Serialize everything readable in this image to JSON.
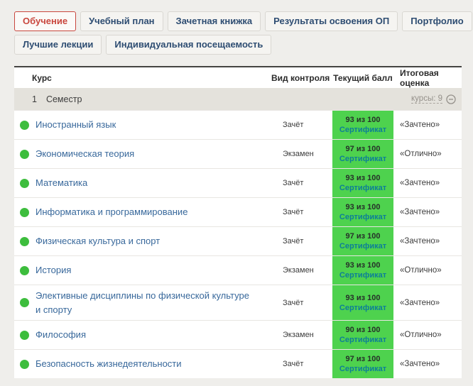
{
  "tabs": {
    "row1": [
      {
        "label": "Обучение",
        "active": true
      },
      {
        "label": "Учебный план",
        "active": false
      },
      {
        "label": "Зачетная книжка",
        "active": false
      },
      {
        "label": "Результаты освоения ОП",
        "active": false
      },
      {
        "label": "Портфолио",
        "active": false
      }
    ],
    "row2": [
      {
        "label": "Лучшие лекции",
        "active": false
      },
      {
        "label": "Индивидуальная посещаемость",
        "active": false
      }
    ]
  },
  "table": {
    "header": {
      "course": "Курс",
      "control": "Вид контроля",
      "score": "Текущий балл",
      "final": "Итоговая оценка"
    },
    "semester": {
      "number": "1",
      "label": "Семестр",
      "courses_link": "курсы: 9"
    },
    "rows": [
      {
        "name": "Иностранный язык",
        "control": "Зачёт",
        "score": "93 из 100",
        "cert": "Сертификат",
        "grade": "«Зачтено»",
        "status": "green"
      },
      {
        "name": "Экономическая теория",
        "control": "Экзамен",
        "score": "97 из 100",
        "cert": "Сертификат",
        "grade": "«Отлично»",
        "status": "green"
      },
      {
        "name": "Математика",
        "control": "Зачёт",
        "score": "93 из 100",
        "cert": "Сертификат",
        "grade": "«Зачтено»",
        "status": "green"
      },
      {
        "name": "Информатика и программирование",
        "control": "Зачёт",
        "score": "93 из 100",
        "cert": "Сертификат",
        "grade": "«Зачтено»",
        "status": "green"
      },
      {
        "name": "Физическая культура и спорт",
        "control": "Зачёт",
        "score": "97 из 100",
        "cert": "Сертификат",
        "grade": "«Зачтено»",
        "status": "green"
      },
      {
        "name": "История",
        "control": "Экзамен",
        "score": "93 из 100",
        "cert": "Сертификат",
        "grade": "«Отлично»",
        "status": "green"
      },
      {
        "name": "Элективные дисциплины по физической культуре и спорту",
        "control": "Зачёт",
        "score": "93 из 100",
        "cert": "Сертификат",
        "grade": "«Зачтено»",
        "status": "green"
      },
      {
        "name": "Философия",
        "control": "Экзамен",
        "score": "90 из 100",
        "cert": "Сертификат",
        "grade": "«Отлично»",
        "status": "green"
      },
      {
        "name": "Безопасность жизнедеятельности",
        "control": "Зачёт",
        "score": "97 из 100",
        "cert": "Сертификат",
        "grade": "«Зачтено»",
        "status": "green"
      }
    ]
  },
  "colors": {
    "accent_red": "#c9473e",
    "tab_text_blue": "#2e4d72",
    "link_blue": "#38689b",
    "badge_green": "#4ed24e",
    "status_dot_green": "#3dbd3d",
    "cert_teal": "#0d7e98",
    "semester_bg": "#e4e2dc",
    "page_bg": "#efeeeb"
  },
  "icons": {
    "collapse_semester": "minus-circle"
  }
}
